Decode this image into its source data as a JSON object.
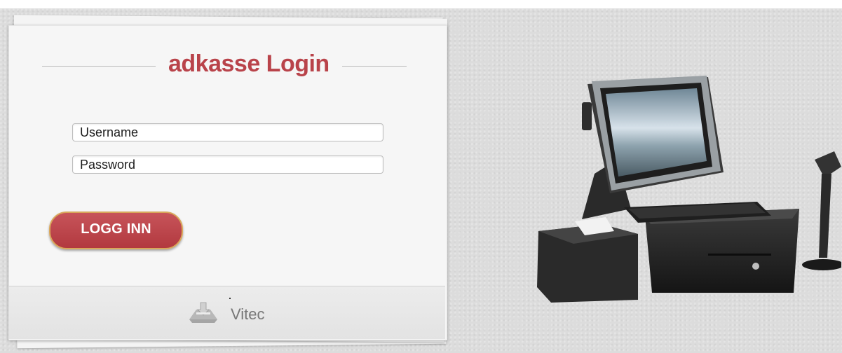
{
  "login": {
    "title": "adkasse Login",
    "username_placeholder": "Username",
    "password_placeholder": "Password",
    "submit_label": "LOGG INN"
  },
  "footer": {
    "brand": "Vitec"
  },
  "colors": {
    "accent": "#b9434a",
    "button_border": "#d9a75a",
    "background": "#dcdcdc"
  },
  "icons": {
    "footer_logo": "vitec-logo-icon",
    "illustration": "pos-terminal-illustration"
  }
}
